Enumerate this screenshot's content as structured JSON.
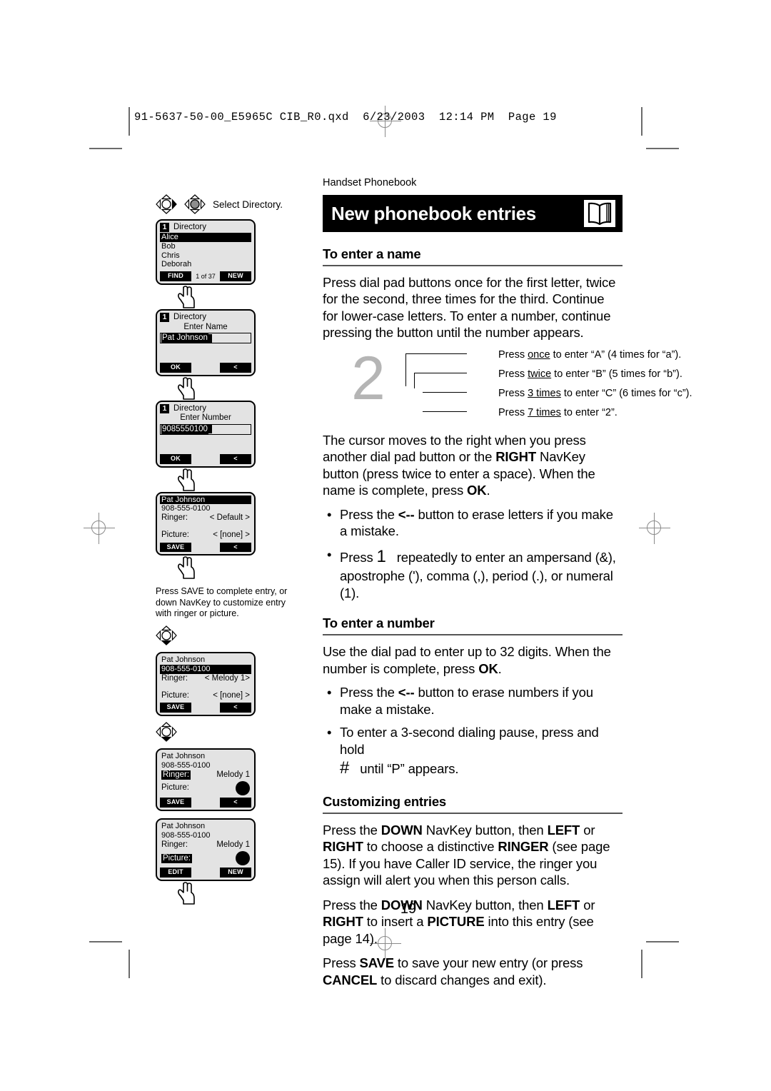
{
  "file_header": "91-5637-50-00_E5965C CIB_R0.qxd  6/23/2003  12:14 PM  Page 19",
  "page_number": "19",
  "right": {
    "kicker": "Handset Phonebook",
    "title": "New phonebook entries",
    "book_icon": "open-book-icon",
    "section_name": {
      "heading": "To enter a name",
      "intro": "Press dial pad buttons once for the first letter, twice for the second, three times for the third. Continue for lower-case letters. To enter a number, continue pressing the button until the number appears.",
      "callout_digit": "2",
      "callout_rows": [
        {
          "pre": "Press ",
          "emph": "once",
          "post": " to enter “A” (4 times for “a”)."
        },
        {
          "pre": "Press ",
          "emph": "twice",
          "post": " to enter “B” (5 times for “b”)."
        },
        {
          "pre": "Press ",
          "emph": "3 times",
          "post": " to enter “C” (6 times for “c”)."
        },
        {
          "pre": "Press ",
          "emph": "7 times",
          "post": " to enter “2”."
        }
      ],
      "cursor_para_1": "The cursor moves to the right when you press another dial pad button or the ",
      "cursor_para_bold_1": "RIGHT",
      "cursor_para_2": " NavKey button (press twice to enter a space). When the name is complete, press ",
      "cursor_para_bold_2": "OK",
      "cursor_para_3": ".",
      "bullet_1_a": "Press the ",
      "bullet_1_b": "<--",
      "bullet_1_c": " button to erase letters if you make a mistake.",
      "bullet_2_a": "Press ",
      "bullet_2_key": "1",
      "bullet_2_b": "repeatedly to enter an ampersand (&), apostrophe ('), comma (,), period (.), or numeral (1)."
    },
    "section_number": {
      "heading": "To enter a number",
      "intro_a": "Use the dial pad to enter up to 32 digits. When the number is complete, press ",
      "intro_bold": "OK",
      "intro_b": ".",
      "bullet_1_a": "Press the ",
      "bullet_1_b": "<--",
      "bullet_1_c": " button to erase numbers if you make a mistake.",
      "bullet_2_a": "To enter a 3-second dialing pause, press and hold",
      "bullet_2_key": "#",
      "bullet_2_b": "until “P” appears."
    },
    "section_custom": {
      "heading": "Customizing entries",
      "p1_a": "Press the ",
      "p1_b1": "DOWN",
      "p1_b": " NavKey button, then ",
      "p1_b2": "LEFT",
      "p1_c": " or ",
      "p1_b3": "RIGHT",
      "p1_d": " to choose a distinctive ",
      "p1_b4": "RINGER",
      "p1_e": " (see page 15). If you have Caller ID service, the ringer you assign will alert you when this person calls.",
      "p2_a": "Press the ",
      "p2_b1": "DOWN",
      "p2_b": " NavKey button, then ",
      "p2_b2": "LEFT",
      "p2_c": " or ",
      "p2_b3": "RIGHT",
      "p2_d": " to insert a ",
      "p2_b4": "PICTURE",
      "p2_e": " into this entry (see page 14).",
      "p3_a": "Press ",
      "p3_b1": "SAVE",
      "p3_b": " to save your new entry (or press ",
      "p3_b2": "CANCEL",
      "p3_c": " to discard changes and exit)."
    }
  },
  "left": {
    "nav_label_1": "Select Directory.",
    "screen_directory": {
      "badge": "1",
      "title": "Directory",
      "items": [
        "Alice",
        "Bob",
        "Chris",
        "Deborah"
      ],
      "selected_index": 0,
      "soft_left": "FIND",
      "soft_mid": "1 of 37",
      "soft_right": "NEW"
    },
    "screen_enter_name": {
      "badge": "1",
      "title": "Directory",
      "prompt": "Enter Name",
      "value": "Pat Johnson",
      "soft_left": "OK",
      "soft_right": "<"
    },
    "screen_enter_number": {
      "badge": "1",
      "title": "Directory",
      "prompt": "Enter Number",
      "value": "9085550100",
      "soft_left": "OK",
      "soft_right": "<"
    },
    "screen_entry_default": {
      "name": "Pat Johnson",
      "number": "908-555-0100",
      "ringer_label": "Ringer:",
      "ringer_value": "< Default >",
      "picture_label": "Picture:",
      "picture_value": "< [none] >",
      "soft_left": "SAVE",
      "soft_right": "<"
    },
    "caption_save": "Press SAVE to complete entry, or down NavKey to customize entry with ringer or picture.",
    "screen_entry_melody": {
      "name": "Pat Johnson",
      "number": "908-555-0100",
      "ringer_label": "Ringer:",
      "ringer_value": "< Melody 1>",
      "picture_label": "Picture:",
      "picture_value": "< [none] >",
      "soft_left": "SAVE",
      "soft_right": "<"
    },
    "screen_ringer_selected": {
      "name": "Pat Johnson",
      "number": "908-555-0100",
      "ringer_label": "Ringer:",
      "ringer_value": "Melody 1",
      "picture_label": "Picture:",
      "soft_left": "SAVE",
      "soft_right": "<"
    },
    "screen_picture_selected": {
      "name": "Pat Johnson",
      "number": "908-555-0100",
      "ringer_label": "Ringer:",
      "ringer_value": "Melody 1",
      "picture_label": "Picture:",
      "soft_left": "EDIT",
      "soft_right": "NEW"
    }
  }
}
